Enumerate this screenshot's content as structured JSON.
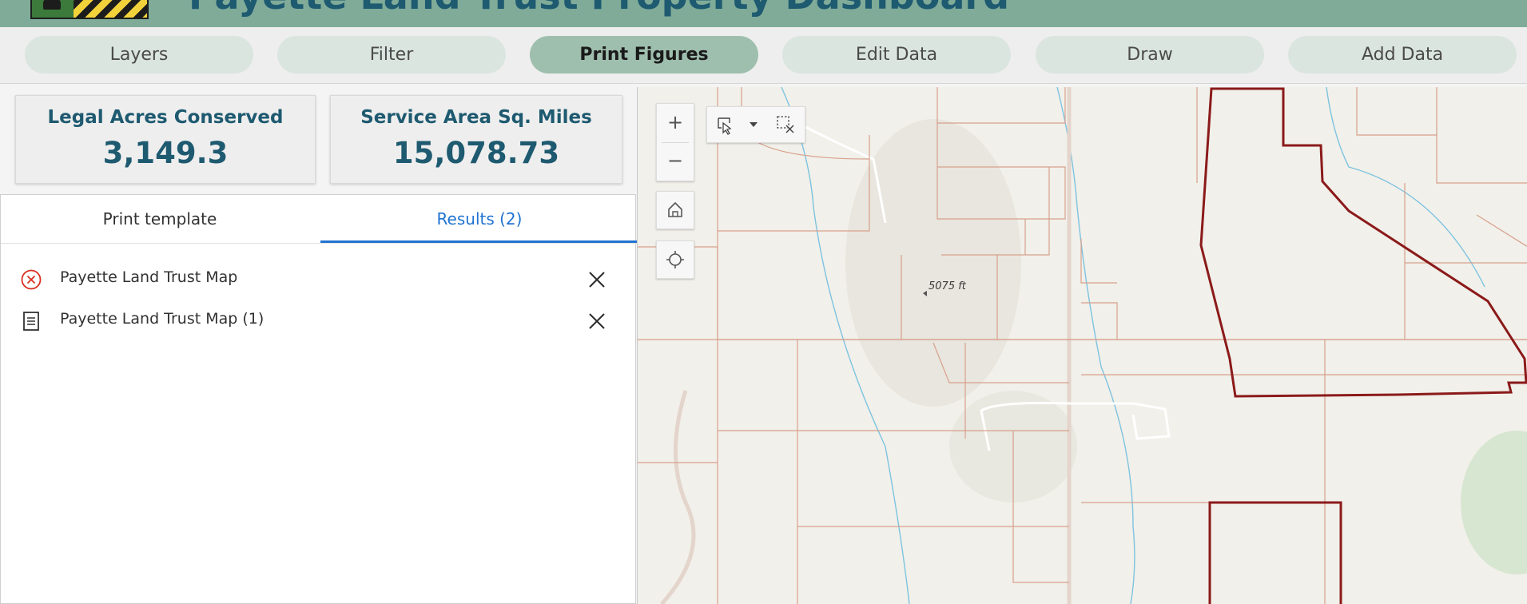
{
  "header": {
    "title": "Payette Land Trust Property Dashboard"
  },
  "nav": {
    "items": [
      {
        "label": "Layers"
      },
      {
        "label": "Filter"
      },
      {
        "label": "Print Figures"
      },
      {
        "label": "Edit Data"
      },
      {
        "label": "Draw"
      },
      {
        "label": "Add Data"
      }
    ],
    "active": "Print Figures"
  },
  "stats": [
    {
      "label": "Legal Acres Conserved",
      "value": "3,149.3"
    },
    {
      "label": "Service Area Sq. Miles",
      "value": "15,078.73"
    }
  ],
  "print_panel": {
    "tabs": [
      {
        "label": "Print template"
      },
      {
        "label": "Results (2)"
      }
    ],
    "active_tab": "Results (2)",
    "results": [
      {
        "name": "Payette Land Trust Map",
        "status": "error",
        "icon": "error-circle-icon"
      },
      {
        "name": "Payette Land Trust Map (1)",
        "status": "done",
        "icon": "document-icon"
      }
    ]
  },
  "map": {
    "elevation_label": "5075 ft",
    "controls": [
      "zoom-in-icon",
      "zoom-out-icon",
      "home-icon",
      "locate-icon",
      "select-icon",
      "dropdown-icon",
      "clear-selection-icon"
    ]
  },
  "colors": {
    "header_bg": "#7fab98",
    "accent": "#1e5a70",
    "tab_active": "#1f73d1",
    "parcel": "#d8a08c",
    "boundary": "#8b1a1a",
    "stream": "#7ec3e0"
  }
}
